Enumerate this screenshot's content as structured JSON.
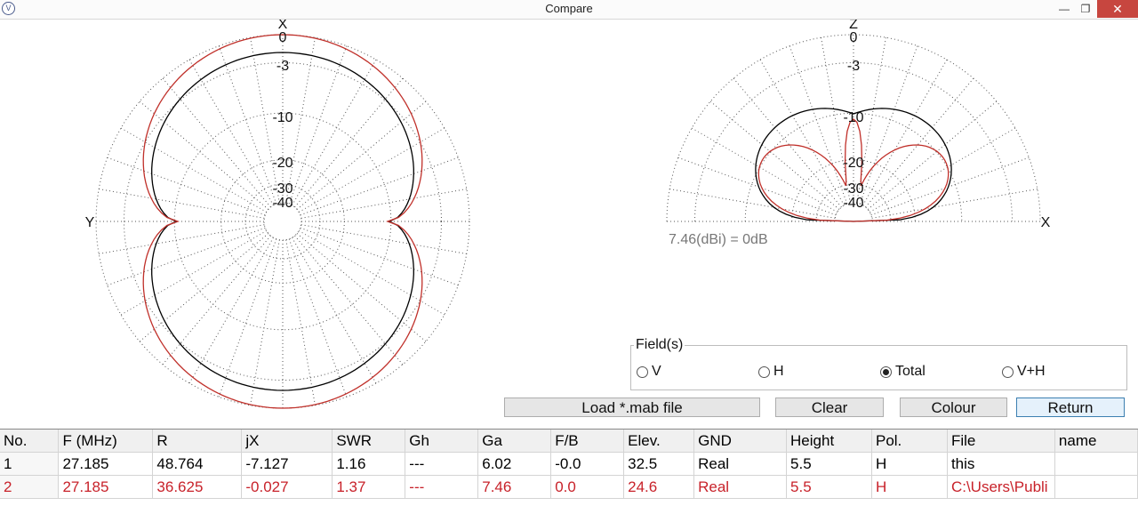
{
  "window": {
    "title": "Compare",
    "icon": "app-icon",
    "controls": [
      "minimize-icon",
      "maximize-icon",
      "close-icon"
    ]
  },
  "azimuth": {
    "axis_top": "X",
    "axis_left": "Y",
    "db_labels": [
      "0",
      "-3",
      "-10",
      "-20",
      "-30",
      "-40"
    ]
  },
  "elevation": {
    "axis_top": "Z",
    "axis_right": "X",
    "db_labels": [
      "0",
      "-3",
      "-10",
      "-20",
      "-30",
      "-40"
    ],
    "gain_ref": "7.46(dBi) = 0dB"
  },
  "colors": {
    "trace1": "#000000",
    "trace2": "#c0302a",
    "grid": "#555555"
  },
  "fields": {
    "legend": "Field(s)",
    "options": [
      "V",
      "H",
      "Total",
      "V+H"
    ],
    "selected": "Total"
  },
  "buttons": {
    "load": "Load *.mab file",
    "clear": "Clear",
    "colour": "Colour",
    "return": "Return"
  },
  "table": {
    "headers": [
      "No.",
      "F (MHz)",
      "R",
      "jX",
      "SWR",
      "Gh",
      "Ga",
      "F/B",
      "Elev.",
      "GND",
      "Height",
      "Pol.",
      "File",
      "name"
    ],
    "rows": [
      [
        "1",
        "27.185",
        "48.764",
        "-7.127",
        "1.16",
        "---",
        "6.02",
        "-0.0",
        "32.5",
        "Real",
        "5.5",
        "H",
        "this",
        ""
      ],
      [
        "2",
        "27.185",
        "36.625",
        "-0.027",
        "1.37",
        "---",
        "7.46",
        "0.0",
        "24.6",
        "Real",
        "5.5",
        "H",
        "C:\\Users\\Publi",
        ""
      ]
    ]
  }
}
